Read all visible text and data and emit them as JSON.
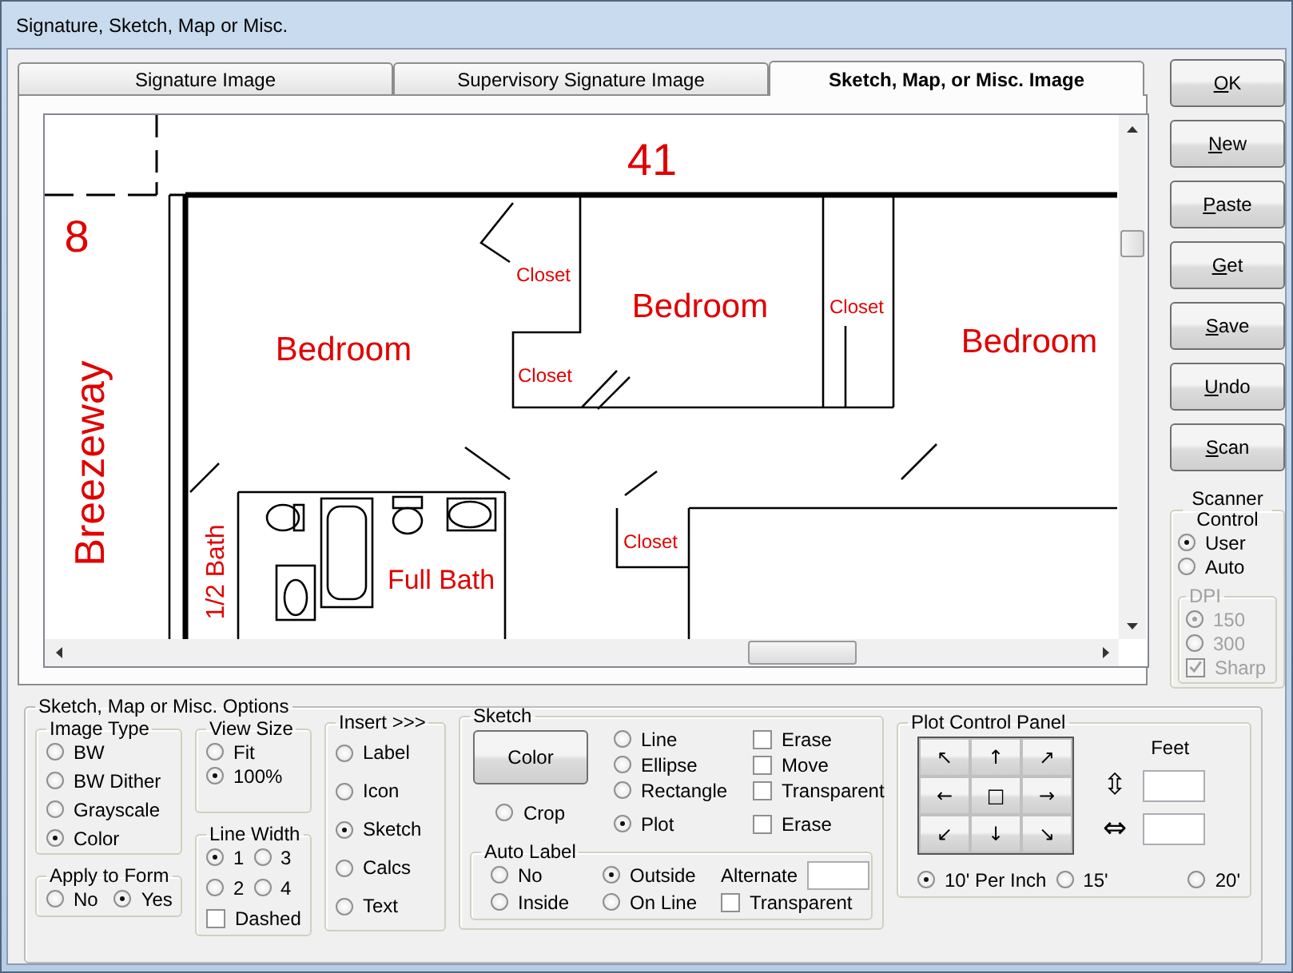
{
  "window": {
    "title": "Signature, Sketch, Map or Misc."
  },
  "tabs": [
    {
      "label": "Signature Image",
      "selected": false
    },
    {
      "label": "Supervisory Signature Image",
      "selected": false
    },
    {
      "label": "Sketch, Map, or Misc. Image",
      "selected": true
    }
  ],
  "sketch_labels": [
    {
      "text": "41",
      "kind": "street"
    },
    {
      "text": "8",
      "kind": "street"
    },
    {
      "text": "Breezeway",
      "kind": "vertical_large"
    },
    {
      "text": "Bedroom",
      "kind": "room"
    },
    {
      "text": "Closet",
      "kind": "closet"
    },
    {
      "text": "Closet",
      "kind": "closet"
    },
    {
      "text": "Bedroom",
      "kind": "room"
    },
    {
      "text": "Closet",
      "kind": "closet"
    },
    {
      "text": "Bedroom",
      "kind": "room"
    },
    {
      "text": "1/2 Bath",
      "kind": "vertical_small"
    },
    {
      "text": "Full Bath",
      "kind": "bath"
    },
    {
      "text": "Closet",
      "kind": "closet"
    }
  ],
  "buttons": [
    "OK",
    "New",
    "Paste",
    "Get",
    "Save",
    "Undo",
    "Scan"
  ],
  "scanner_control": {
    "title": "Scanner Control",
    "options": [
      {
        "label": "User",
        "selected": true
      },
      {
        "label": "Auto",
        "selected": false
      }
    ],
    "dpi": {
      "title": "DPI",
      "disabled": true,
      "options": [
        {
          "label": "150",
          "selected": true
        },
        {
          "label": "300",
          "selected": false
        }
      ],
      "sharp": {
        "label": "Sharp",
        "checked": true
      }
    }
  },
  "options": {
    "title": "Sketch, Map or Misc. Options",
    "image_type": {
      "title": "Image Type",
      "options": [
        {
          "label": "BW",
          "selected": false
        },
        {
          "label": "BW Dither",
          "selected": false
        },
        {
          "label": "Grayscale",
          "selected": false
        },
        {
          "label": "Color",
          "selected": true
        }
      ]
    },
    "apply_to_form": {
      "title": "Apply to Form",
      "options": [
        {
          "label": "No",
          "selected": false
        },
        {
          "label": "Yes",
          "selected": true
        }
      ]
    },
    "view_size": {
      "title": "View Size",
      "options": [
        {
          "label": "Fit",
          "selected": false
        },
        {
          "label": "100%",
          "selected": true
        }
      ]
    },
    "line_width": {
      "title": "Line Width",
      "options": [
        {
          "label": "1",
          "selected": true
        },
        {
          "label": "3",
          "selected": false
        },
        {
          "label": "2",
          "selected": false
        },
        {
          "label": "4",
          "selected": false
        }
      ],
      "dashed": {
        "label": "Dashed",
        "checked": false
      }
    },
    "insert": {
      "title": "Insert >>>",
      "options": [
        {
          "label": "Label",
          "selected": false
        },
        {
          "label": "Icon",
          "selected": false
        },
        {
          "label": "Sketch",
          "selected": true
        },
        {
          "label": "Calcs",
          "selected": false
        },
        {
          "label": "Text",
          "selected": false
        }
      ]
    },
    "sketch": {
      "title": "Sketch",
      "color_button": "Color",
      "crop": {
        "label": "Crop",
        "selected": false
      },
      "tools": [
        {
          "label": "Line",
          "selected": false
        },
        {
          "label": "Ellipse",
          "selected": false
        },
        {
          "label": "Rectangle",
          "selected": false
        },
        {
          "label": "Plot",
          "selected": true
        }
      ],
      "toggles": [
        {
          "label": "Erase",
          "checked": false
        },
        {
          "label": "Move",
          "checked": false
        },
        {
          "label": "Transparent",
          "checked": false
        },
        {
          "label": "Erase",
          "checked": false
        }
      ],
      "auto_label": {
        "title": "Auto Label",
        "options": [
          {
            "label": "No",
            "selected": false
          },
          {
            "label": "Outside",
            "selected": true
          },
          {
            "label": "Inside",
            "selected": false
          },
          {
            "label": "On Line",
            "selected": false
          }
        ],
        "alternate_label": "Alternate",
        "transparent": {
          "label": "Transparent",
          "checked": false
        }
      }
    },
    "plot_control": {
      "title": "Plot Control Panel",
      "arrows": [
        "↖",
        "↑",
        "↗",
        "←",
        "□",
        "→",
        "↙",
        "↓",
        "↘"
      ],
      "feet_label": "Feet",
      "vertical_icon": "⇳",
      "horizontal_icon": "⇔",
      "scales": [
        {
          "label": "10' Per Inch",
          "selected": true
        },
        {
          "label": "15'",
          "selected": false
        },
        {
          "label": "20'",
          "selected": false
        }
      ]
    }
  }
}
